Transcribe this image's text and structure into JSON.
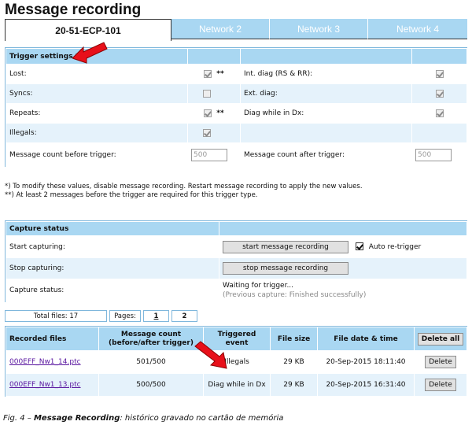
{
  "page_title": "Message recording",
  "tabs": [
    {
      "label": "20-51-ECP-101",
      "active": true
    },
    {
      "label": "Network 2",
      "active": false
    },
    {
      "label": "Network 3",
      "active": false
    },
    {
      "label": "Network 4",
      "active": false
    }
  ],
  "trigger": {
    "header": "Trigger settings *",
    "left": [
      {
        "label": "Lost:",
        "checked": true,
        "mark": "**"
      },
      {
        "label": "Syncs:",
        "checked": false,
        "mark": ""
      },
      {
        "label": "Repeats:",
        "checked": true,
        "mark": "**"
      },
      {
        "label": "Illegals:",
        "checked": true,
        "mark": ""
      }
    ],
    "right": [
      {
        "label": "Int. diag (RS & RR):",
        "checked": true
      },
      {
        "label": "Ext. diag:",
        "checked": true
      },
      {
        "label": "Diag while in Dx:",
        "checked": true
      }
    ],
    "count_before_label": "Message count before trigger:",
    "count_before_value": "500",
    "count_after_label": "Message count after trigger:",
    "count_after_value": "500"
  },
  "notes": {
    "line1": "*) To modify these values, disable message recording. Restart message recording to apply the new values.",
    "line2": "**) At least 2 messages before the trigger are required for this trigger type."
  },
  "capture": {
    "header": "Capture status",
    "start_label": "Start capturing:",
    "start_button": "start message recording",
    "auto_retrigger_label": "Auto re-trigger",
    "auto_retrigger_checked": true,
    "stop_label": "Stop capturing:",
    "stop_button": "stop message recording",
    "status_label": "Capture status:",
    "status_line1": "Waiting for trigger...",
    "status_line2": "(Previous capture: Finished successfully)"
  },
  "pager": {
    "total_files": "Total files: 17",
    "pages_label": "Pages:",
    "pages": [
      "1",
      "2"
    ]
  },
  "files": {
    "headers": {
      "name": "Recorded files",
      "count_l1": "Message count",
      "count_l2": "(before/after trigger)",
      "event_l1": "Triggered",
      "event_l2": "event",
      "size": "File size",
      "date": "File date & time"
    },
    "delete_all": "Delete all",
    "delete": "Delete",
    "rows": [
      {
        "name": "000EFF_Nw1_14.ptc",
        "count": "501/500",
        "event": "Illegals",
        "size": "29 KB",
        "date": "20-Sep-2015 18:11:40"
      },
      {
        "name": "000EFF_Nw1_13.ptc",
        "count": "500/500",
        "event": "Diag while in Dx",
        "size": "29 KB",
        "date": "20-Sep-2015 16:31:40"
      }
    ]
  },
  "caption": {
    "prefix": "Fig. 4 – ",
    "bold": "Message Recording",
    "rest": ": histórico gravado no cartão de memória"
  },
  "colors": {
    "header_bg": "#a9d7f2",
    "row_alt_bg": "#e5f2fb",
    "arrow_red": "#e8101a",
    "link": "#5a17a0"
  }
}
